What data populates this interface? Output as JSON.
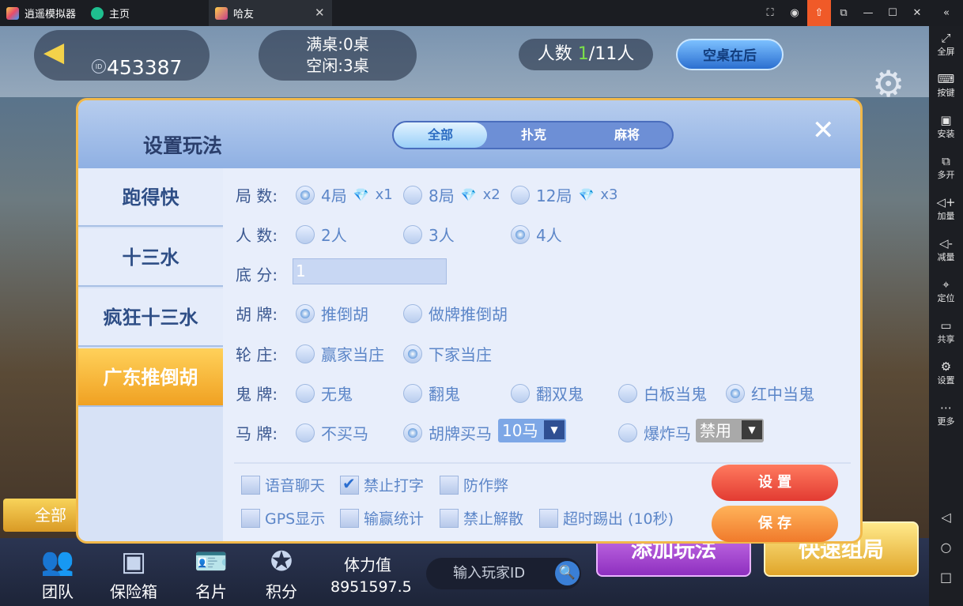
{
  "titlebar": {
    "app_name": "逍遥模拟器",
    "tabs": [
      {
        "label": "主页"
      },
      {
        "label": "哈友"
      }
    ]
  },
  "sidebar": {
    "items": [
      {
        "label": "全屏",
        "icon": "fullscreen-icon"
      },
      {
        "label": "按键",
        "icon": "keyboard-icon"
      },
      {
        "label": "安装",
        "icon": "apk-install-icon"
      },
      {
        "label": "多开",
        "icon": "multi-instance-icon"
      },
      {
        "label": "加量",
        "icon": "volume-up-icon"
      },
      {
        "label": "减量",
        "icon": "volume-down-icon"
      },
      {
        "label": "定位",
        "icon": "location-icon"
      },
      {
        "label": "共享",
        "icon": "folder-share-icon"
      },
      {
        "label": "设置",
        "icon": "gear-icon"
      },
      {
        "label": "更多",
        "icon": "more-icon"
      }
    ]
  },
  "game": {
    "room_id": "453387",
    "full_tables": "满桌:0桌",
    "idle_tables": "空闲:3桌",
    "people_prefix": "人数 ",
    "people_current": "1",
    "people_suffix": "/11人",
    "empty_tables_btn": "空桌在后",
    "all_btn": "全部",
    "bottom": {
      "team": "团队",
      "safe": "保险箱",
      "card": "名片",
      "points": "积分",
      "stamina_label": "体力值",
      "stamina_value": "8951597.5",
      "search_placeholder": "输入玩家ID",
      "add_play": "添加玩法",
      "quick": "快速组局"
    }
  },
  "dialog": {
    "title": "设置玩法",
    "tabs": [
      {
        "label": "全部"
      },
      {
        "label": "扑克"
      },
      {
        "label": "麻将"
      }
    ],
    "games": [
      {
        "label": "跑得快"
      },
      {
        "label": "十三水"
      },
      {
        "label": "疯狂十三水"
      },
      {
        "label": "广东推倒胡"
      }
    ],
    "labels": {
      "rounds": "局 数:",
      "players": "人 数:",
      "base": "底 分:",
      "hu": "胡 牌:",
      "dealer": "轮 庄:",
      "ghost": "鬼 牌:",
      "horse": "马 牌:"
    },
    "rounds": [
      {
        "label": "4局",
        "mult": "x1"
      },
      {
        "label": "8局",
        "mult": "x2"
      },
      {
        "label": "12局",
        "mult": "x3"
      }
    ],
    "players": [
      "2人",
      "3人",
      "4人"
    ],
    "base_value": "1",
    "hu": [
      "推倒胡",
      "做牌推倒胡"
    ],
    "dealer": [
      "赢家当庄",
      "下家当庄"
    ],
    "ghost": [
      "无鬼",
      "翻鬼",
      "翻双鬼",
      "白板当鬼",
      "红中当鬼"
    ],
    "horse": {
      "opt1": "不买马",
      "opt2": "胡牌买马",
      "opt2_select": "10马",
      "opt3": "爆炸马",
      "opt3_select": "禁用"
    },
    "checks": {
      "voice": "语音聊天",
      "notype": "禁止打字",
      "anticheat": "防作弊",
      "gps": "GPS显示",
      "stats": "输赢统计",
      "nodissolve": "禁止解散",
      "timeout": "超时踢出 (10秒)"
    },
    "btn_set": "设 置",
    "btn_save": "保 存"
  }
}
